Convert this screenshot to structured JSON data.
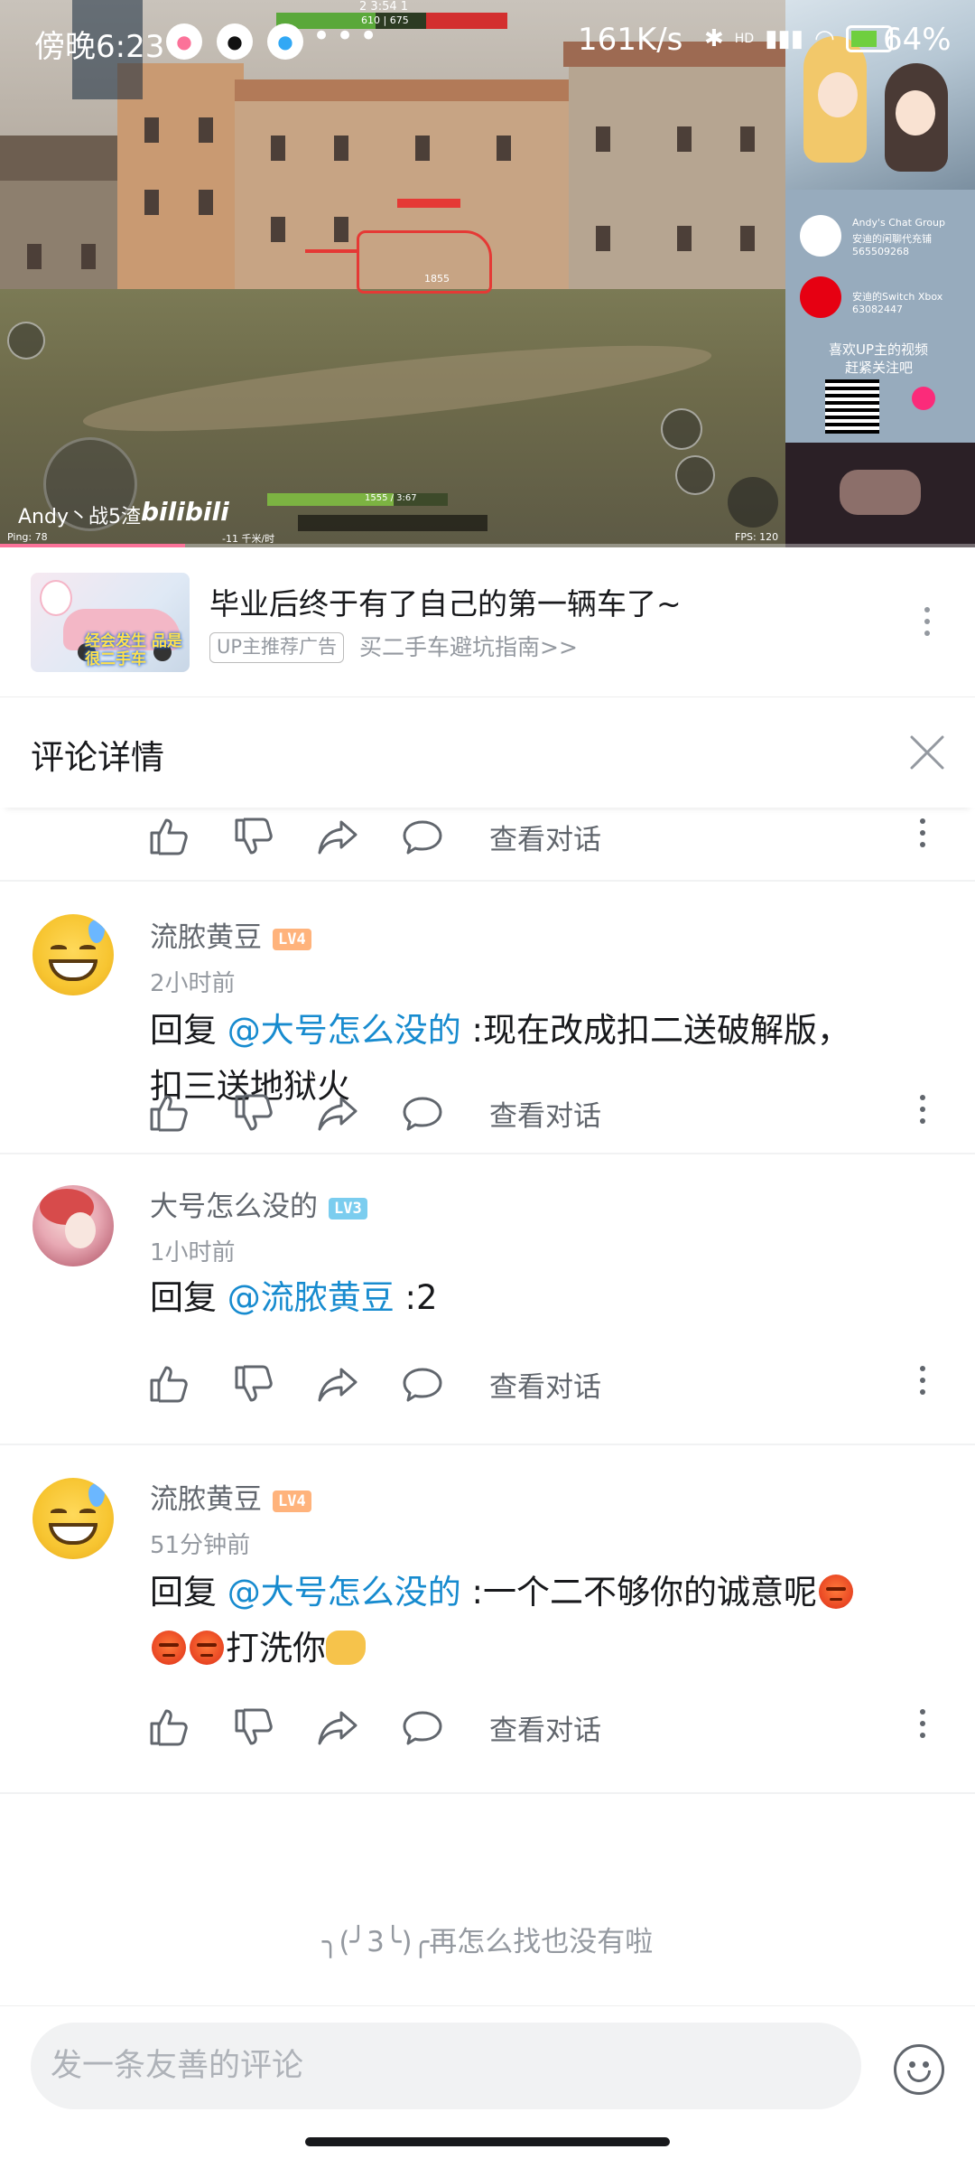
{
  "status_bar": {
    "time": "傍晚6:23",
    "net_speed": "161K/s",
    "battery": "64%",
    "hd_label": "HD"
  },
  "video": {
    "uploader_watermark": "Andy丶战5渣",
    "site_watermark": "bilibili",
    "hud_score_left": "2",
    "hud_timer": "3:54",
    "hud_score_right": "1",
    "hud_hp": "610 | 675",
    "tank_hp": "1855",
    "bottom_hp": "1555 / 3:67",
    "fps": "FPS: 120",
    "ping": "Ping: 78",
    "distance": "-11 千米/时",
    "panel_line1": "Andy's Chat Group",
    "panel_line2": "安迪的闲聊代充铺",
    "panel_line3": "565509268",
    "panel_line4": "安迪的Switch Xbox",
    "panel_line5": "63082447",
    "panel_line6": "喜欢UP主的视频",
    "panel_line7": "赶紧关注吧",
    "progress_fraction": 0.19
  },
  "ad": {
    "thumb_caption": "经会发生 品是很二手车",
    "title": "毕业后终于有了自己的第一辆车了~",
    "badge": "UP主推荐广告",
    "subtitle": "买二手车避坑指南>>"
  },
  "comment_detail": {
    "title": "评论详情"
  },
  "actions": {
    "view_conversation": "查看对话"
  },
  "comments": [
    {
      "user": "流脓黄豆",
      "level": "LV4",
      "level_color": "#ffb37c",
      "time": "2小时前",
      "reply_prefix": "回复 ",
      "mention": "@大号怎么没的",
      "text_line1": " :现在改成扣二送破解版，",
      "text_line2": "扣三送地狱火"
    },
    {
      "user": "大号怎么没的",
      "level": "LV3",
      "level_color": "#7bcdef",
      "time": "1小时前",
      "reply_prefix": "回复 ",
      "mention": "@流脓黄豆",
      "text_line1": " :2"
    },
    {
      "user": "流脓黄豆",
      "level": "LV4",
      "level_color": "#ffb37c",
      "time": "51分钟前",
      "reply_prefix": "回复 ",
      "mention": "@大号怎么没的",
      "text_line1": " :一个二不够你的诚意呢",
      "text_line2": "打洗你"
    }
  ],
  "end_note": "╮(╯3╰)╭再怎么找也没有啦",
  "input": {
    "placeholder": "发一条友善的评论"
  },
  "colors": {
    "mention": "#178bcf",
    "accent_pink": "#fb7299",
    "text_primary": "#18191c",
    "text_secondary": "#61666d",
    "text_muted": "#9499a0"
  }
}
